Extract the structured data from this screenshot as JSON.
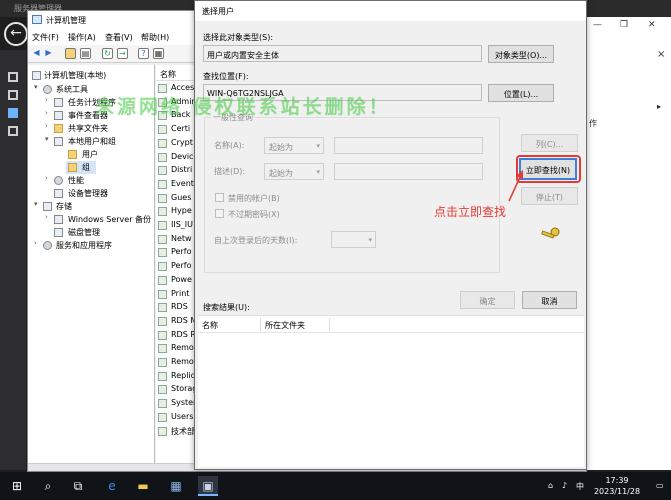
{
  "server_manager": {
    "title": "服务器管理器",
    "right_text": "作",
    "right_arrow": "▸",
    "close_glyph": "×"
  },
  "computer_management": {
    "title": "计算机管理",
    "menu": [
      "文件(F)",
      "操作(A)",
      "查看(V)",
      "帮助(H)"
    ],
    "tree": {
      "root": "计算机管理(本地)",
      "system_tools": "系统工具",
      "task_scheduler": "任务计划程序",
      "event_viewer": "事件查看器",
      "shared_folders": "共享文件夹",
      "local_users_groups": "本地用户和组",
      "users": "用户",
      "groups": "组",
      "performance": "性能",
      "device_manager": "设备管理器",
      "storage": "存储",
      "windows_server_backup": "Windows Server 备份",
      "disk_management": "磁盘管理",
      "services_apps": "服务和应用程序"
    },
    "list_header": "名称",
    "list_items": [
      "Access",
      "Admin",
      "Back",
      "Certi",
      "Crypt",
      "Devic",
      "Distri",
      "Event",
      "Gues",
      "Hype",
      "IIS_IU",
      "Netw",
      "Perfo",
      "Perfo",
      "Powe",
      "Print",
      "RDS",
      "RDS M",
      "RDS R",
      "Remot",
      "Remot",
      "Replic",
      "Storag",
      "Syster",
      "Users",
      "技术部"
    ]
  },
  "dialog": {
    "title": "选择用户",
    "object_type_label": "选择此对象类型(S):",
    "object_type_value": "用户或内置安全主体",
    "object_types_button": "对象类型(O)...",
    "location_label": "查找位置(F):",
    "location_value": "WIN-Q6TG2NSLJGA",
    "locations_button": "位置(L)...",
    "general_queries": "一般性查询",
    "name_label": "名称(A):",
    "description_label": "描述(D):",
    "starts_with": "起始为",
    "disabled_accounts": "禁用的帐户(B)",
    "non_expiring_password": "不过期密码(X)",
    "days_since_logon": "自上次登录后的天数(I):",
    "columns_button": "列(C)...",
    "find_now_button": "立即查找(N)",
    "stop_button": "停止(T)",
    "search_results_label": "搜索结果(U):",
    "ok_button": "确定",
    "cancel_button": "取消",
    "results_columns": [
      "名称",
      "所在文件夹"
    ],
    "close_glyph": "×"
  },
  "annotation": "点击立即查找",
  "watermark": "未源网络    侵权联系站长删除！",
  "taskbar": {
    "ime": "中",
    "time": "17:39",
    "date": "2023/11/28"
  },
  "colors": {
    "accent_red": "#e53935",
    "find_button_border": "#3c7fd4",
    "watermark": "#3cc83c",
    "taskbar": "#101418"
  }
}
